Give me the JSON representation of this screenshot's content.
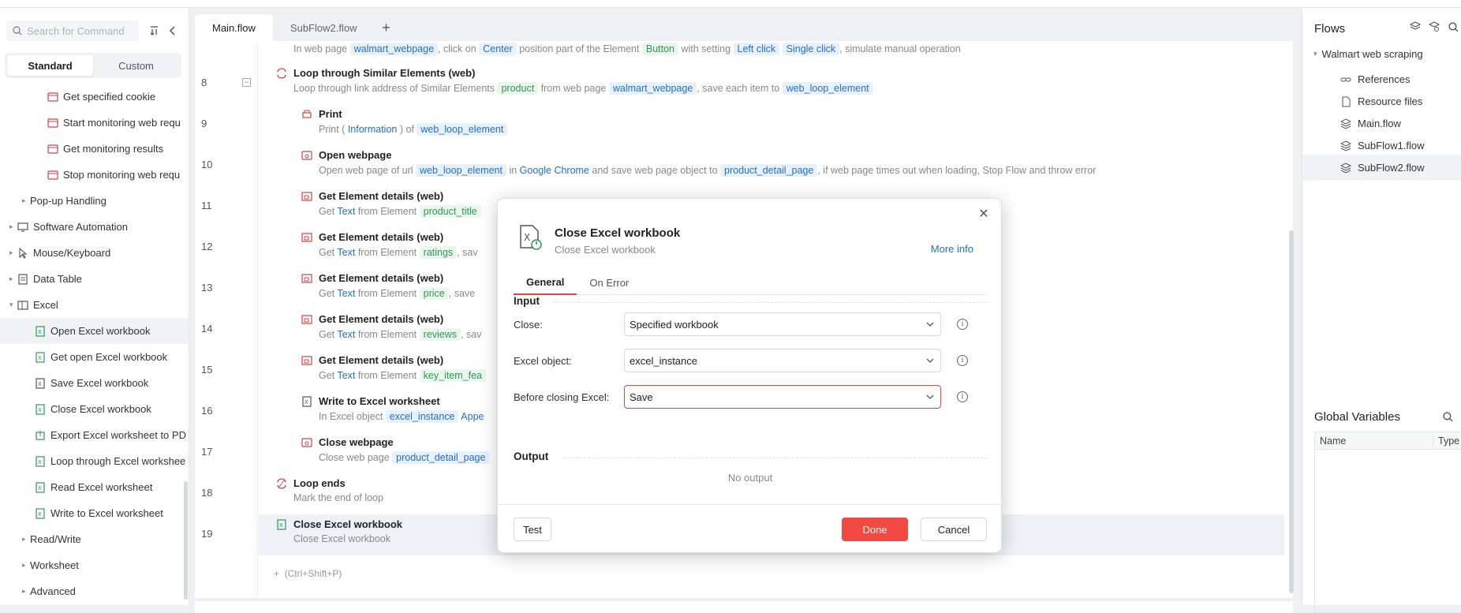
{
  "left": {
    "search_placeholder": "Search for Command",
    "segments": [
      "Standard",
      "Custom"
    ],
    "items": [
      {
        "label": "Get specified cookie"
      },
      {
        "label": "Start monitoring web requ"
      },
      {
        "label": "Get monitoring results"
      },
      {
        "label": "Stop monitoring web requ"
      },
      {
        "label": "Pop-up Handling"
      },
      {
        "label": "Software Automation"
      },
      {
        "label": "Mouse/Keyboard"
      },
      {
        "label": "Data Table"
      },
      {
        "label": "Excel"
      },
      {
        "label": "Open Excel workbook"
      },
      {
        "label": "Get open Excel workbook"
      },
      {
        "label": "Save Excel workbook"
      },
      {
        "label": "Close Excel workbook"
      },
      {
        "label": "Export Excel worksheet to PD"
      },
      {
        "label": "Loop through Excel workshee"
      },
      {
        "label": "Read Excel worksheet"
      },
      {
        "label": "Write to Excel worksheet"
      },
      {
        "label": "Read/Write"
      },
      {
        "label": "Worksheet"
      },
      {
        "label": "Advanced"
      }
    ]
  },
  "tabs": [
    "Main.flow",
    "SubFlow2.flow"
  ],
  "editor": {
    "lines": [
      "8",
      "9",
      "10",
      "11",
      "12",
      "13",
      "14",
      "15",
      "16",
      "17",
      "18",
      "19"
    ],
    "top_desc": {
      "a": "In web page",
      "b": "walmart_webpage",
      "c": ", click on",
      "d": "Center",
      "e": "position  part of the Element",
      "f": "Button",
      "g": "with setting",
      "h": "Left click",
      "i": "Single click",
      "j": ", simulate manual operation"
    },
    "loop": {
      "title": "Loop through Similar Elements (web)",
      "a": "Loop through link address of Similar Elements",
      "b": "product",
      "c": "from web page",
      "d": "walmart_webpage",
      "e": ", save each item to",
      "f": "web_loop_element"
    },
    "print": {
      "title": "Print",
      "a": "Print (",
      "b": "Information",
      "c": ") of",
      "d": "web_loop_element"
    },
    "open": {
      "title": "Open webpage",
      "a": "Open web page of url",
      "b": "web_loop_element",
      "c": "in",
      "d": "Google Chrome",
      "e": "and save web page object to",
      "f": "product_detail_page",
      "g": ", if web page times out when loading, Stop Flow and throw error"
    },
    "get1": {
      "title": "Get Element details (web)",
      "a": "Get",
      "b": "Text",
      "c": "from Element",
      "d": "product_title"
    },
    "get2": {
      "title": "Get Element details (web)",
      "a": "Get",
      "b": "Text",
      "c": "from Element",
      "d": "ratings",
      "e": ", sav"
    },
    "get3": {
      "title": "Get Element details (web)",
      "a": "Get",
      "b": "Text",
      "c": "from Element",
      "d": "price",
      "e": ", save"
    },
    "get4": {
      "title": "Get Element details (web)",
      "a": "Get",
      "b": "Text",
      "c": "from Element",
      "d": "reviews",
      "e": ", sav"
    },
    "get5": {
      "title": "Get Element details (web)",
      "a": "Get",
      "b": "Text",
      "c": "from Element",
      "d": "key_item_fea"
    },
    "write": {
      "title": "Write to Excel worksheet",
      "a": "In Excel object",
      "b": "excel_instance",
      "c": "Appe"
    },
    "closeweb": {
      "title": "Close webpage",
      "a": "Close web page",
      "b": "product_detail_page"
    },
    "loopend": {
      "title": "Loop ends",
      "a": "Mark the end of loop"
    },
    "closexl": {
      "title": "Close Excel workbook",
      "a": "Close Excel workbook"
    },
    "add_hint": "(Ctrl+Shift+P)"
  },
  "right": {
    "flows_title": "Flows",
    "root": "Walmart web scraping",
    "items": [
      "References",
      "Resource files",
      "Main.flow",
      "SubFlow1.flow",
      "SubFlow2.flow"
    ],
    "gv_title": "Global Variables",
    "gv_cols": [
      "Name",
      "Type"
    ]
  },
  "dialog": {
    "title": "Close Excel workbook",
    "subtitle": "Close Excel workbook",
    "more_info": "More info",
    "tabs": [
      "General",
      "On Error"
    ],
    "input_label": "Input",
    "fields": [
      {
        "label": "Close:",
        "value": "Specified workbook"
      },
      {
        "label": "Excel object:",
        "value": "excel_instance"
      },
      {
        "label": "Before closing Excel:",
        "value": "Save"
      }
    ],
    "output_label": "Output",
    "no_output": "No output",
    "test": "Test",
    "done": "Done",
    "cancel": "Cancel"
  },
  "colors": {
    "accent": "#f04a42",
    "link": "#1f6fd1",
    "chip_green": "#2e9a4f"
  }
}
